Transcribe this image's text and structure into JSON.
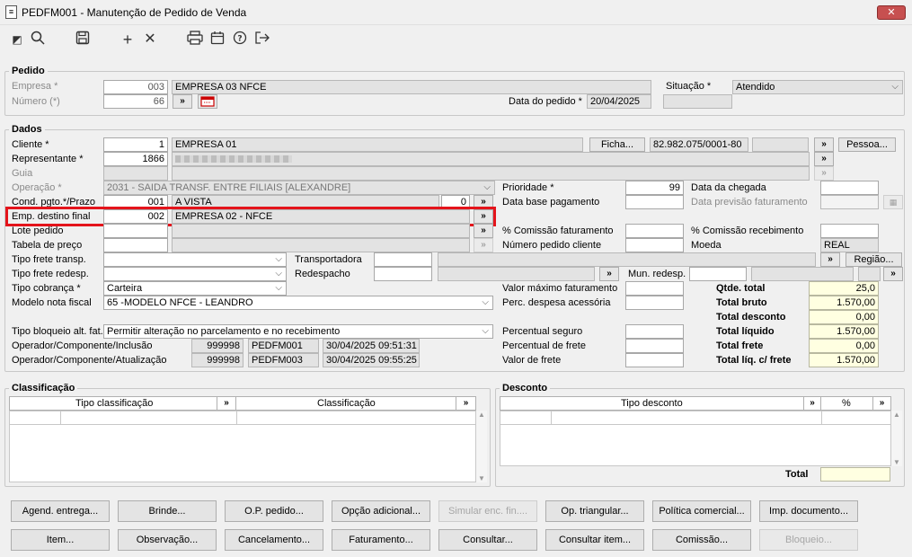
{
  "window": {
    "title": "PEDFM001 - Manutenção de Pedido de Venda",
    "close": "✕"
  },
  "pedido": {
    "title": "Pedido",
    "empresa_label": "Empresa *",
    "empresa_code": "003",
    "empresa_name": "EMPRESA 03 NFCE",
    "numero_label": "Número (*)",
    "numero": "66",
    "situacao_label": "Situação *",
    "situacao": "Atendido",
    "data_label": "Data do pedido *",
    "data": "20/04/2025"
  },
  "dados": {
    "title": "Dados",
    "cliente_label": "Cliente *",
    "cliente_code": "1",
    "cliente_name": "EMPRESA 01",
    "ficha": "Ficha...",
    "cnpj": "82.982.075/0001-80",
    "pessoa": "Pessoa...",
    "representante_label": "Representante *",
    "representante_code": "1866",
    "guia_label": "Guia",
    "operacao_label": "Operação *",
    "operacao": "2031 - SAIDA TRANSF. ENTRE FILIAIS [ALEXANDRE]",
    "cond_label": "Cond. pgto.*/Prazo",
    "cond_code": "001",
    "cond_name": "A VISTA",
    "cond_prazo": "0",
    "emp_destino_label": "Emp. destino final",
    "emp_destino_code": "002",
    "emp_destino_name": "EMPRESA 02 - NFCE",
    "lote_label": "Lote pedido",
    "tabela_label": "Tabela de preço",
    "frete_transp_label": "Tipo frete transp.",
    "frete_redesp_label": "Tipo frete redesp.",
    "cobranca_label": "Tipo cobrança *",
    "cobranca": "Carteira",
    "modelo_label": "Modelo nota fiscal",
    "modelo": "65 -MODELO NFCE - LEANDRO",
    "bloqueio_label": "Tipo bloqueio alt. fat.",
    "bloqueio": "Permitir alteração no parcelamento e no recebimento",
    "op_inclusao_label": "Operador/Componente/Inclusão",
    "op_inclusao_code": "999998",
    "op_inclusao_comp": "PEDFM001",
    "op_inclusao_date": "30/04/2025 09:51:31",
    "op_atualizacao_label": "Operador/Componente/Atualização",
    "op_atualizacao_code": "999998",
    "op_atualizacao_comp": "PEDFM003",
    "op_atualizacao_date": "30/04/2025 09:55:25",
    "transportadora_label": "Transportadora",
    "redespacho_label": "Redespacho",
    "regiao": "Região...",
    "mun_redesp_label": "Mun. redesp.",
    "prioridade_label": "Prioridade *",
    "prioridade": "99",
    "data_base_label": "Data base pagamento",
    "comissao_fat_label": "% Comissão faturamento",
    "num_pedido_cliente_label": "Número pedido cliente",
    "valor_max_label": "Valor máximo faturamento",
    "perc_despesa_label": "Perc. despesa acessória",
    "perc_seguro_label": "Percentual seguro",
    "perc_frete_label": "Percentual de frete",
    "valor_frete_label": "Valor de frete",
    "data_chegada_label": "Data da chegada",
    "data_prev_label": "Data previsão faturamento",
    "comissao_rec_label": "% Comissão recebimento",
    "moeda_label": "Moeda",
    "moeda": "REAL",
    "qtde_total_label": "Qtde. total",
    "qtde_total": "25,0",
    "total_bruto_label": "Total bruto",
    "total_bruto": "1.570,00",
    "total_desconto_label": "Total desconto",
    "total_desconto": "0,00",
    "total_liquido_label": "Total líquido",
    "total_liquido": "1.570,00",
    "total_frete_label": "Total frete",
    "total_frete": "0,00",
    "total_liq_frete_label": "Total líq. c/ frete",
    "total_liq_frete": "1.570,00"
  },
  "classificacao": {
    "title": "Classificação",
    "col1": "Tipo classificação",
    "col2": "Classificação"
  },
  "desconto": {
    "title": "Desconto",
    "col1": "Tipo desconto",
    "col2": "%",
    "total_label": "Total"
  },
  "buttons": {
    "row1": [
      "Agend. entrega...",
      "Brinde...",
      "O.P. pedido...",
      "Opção adicional...",
      "Simular enc. fin....",
      "Op. triangular...",
      "Política comercial...",
      "Imp. documento..."
    ],
    "row2": [
      "Item...",
      "Observação...",
      "Cancelamento...",
      "Faturamento...",
      "Consultar...",
      "Consultar item...",
      "Comissão...",
      "Bloqueio..."
    ]
  },
  "icons": {
    "more": "»",
    "chevron": "⌵"
  },
  "colors": {
    "highlight": "#e4141b",
    "total_bg": "#ffffe1"
  }
}
